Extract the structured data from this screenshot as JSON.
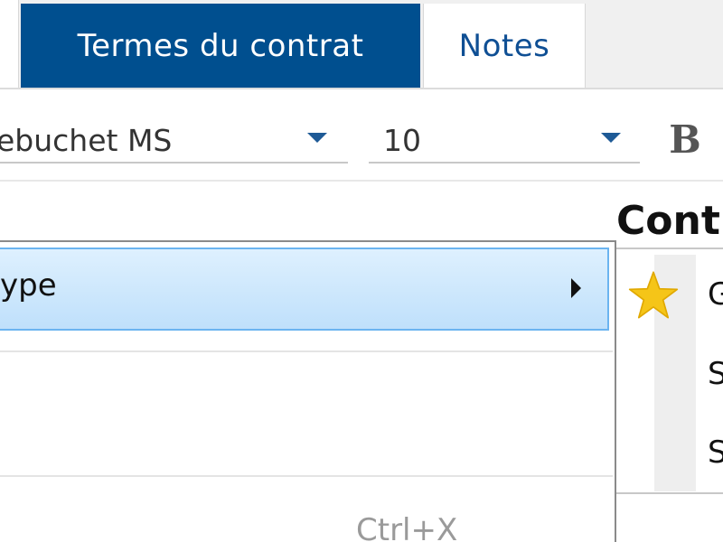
{
  "tabs": {
    "contract_terms": "Termes du contrat",
    "notes": "Notes"
  },
  "toolbar": {
    "font_family_value": "ebuchet MS",
    "font_size_value": "10",
    "bold_label": "B"
  },
  "content": {
    "heading": "Cont"
  },
  "context_menu": {
    "type_item_label": "ype",
    "cut_shortcut": "Ctrl+X"
  },
  "right_panel": {
    "items": [
      "G",
      "S",
      "S"
    ]
  },
  "icons": {
    "dropdown": "chevron-down-icon",
    "submenu": "chevron-right-icon",
    "favorite": "star-icon"
  },
  "colors": {
    "active_tab_bg": "#004f8f",
    "active_tab_text": "#ffffff",
    "inactive_tab_text": "#0f4f94",
    "menu_highlight": "#bfe0fb",
    "menu_highlight_border": "#6bb4f0",
    "star": "#f5c518"
  }
}
